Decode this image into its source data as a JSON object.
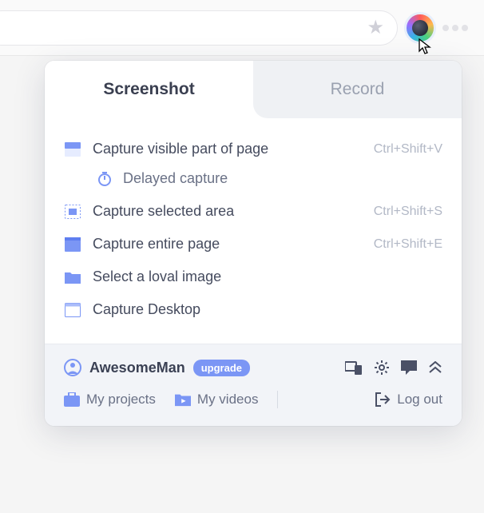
{
  "tabs": {
    "screenshot": "Screenshot",
    "record": "Record"
  },
  "menu": {
    "visible": {
      "label": "Capture visible part of page",
      "shortcut": "Ctrl+Shift+V"
    },
    "delayed": {
      "label": "Delayed capture"
    },
    "selected": {
      "label": "Capture selected area",
      "shortcut": "Ctrl+Shift+S"
    },
    "entire": {
      "label": "Capture entire page",
      "shortcut": "Ctrl+Shift+E"
    },
    "local": {
      "label": "Select a loval image"
    },
    "desktop": {
      "label": "Capture Desktop"
    }
  },
  "footer": {
    "username": "AwesomeMan",
    "upgrade": "upgrade",
    "projects": "My projects",
    "videos": "My videos",
    "logout": "Log out"
  }
}
